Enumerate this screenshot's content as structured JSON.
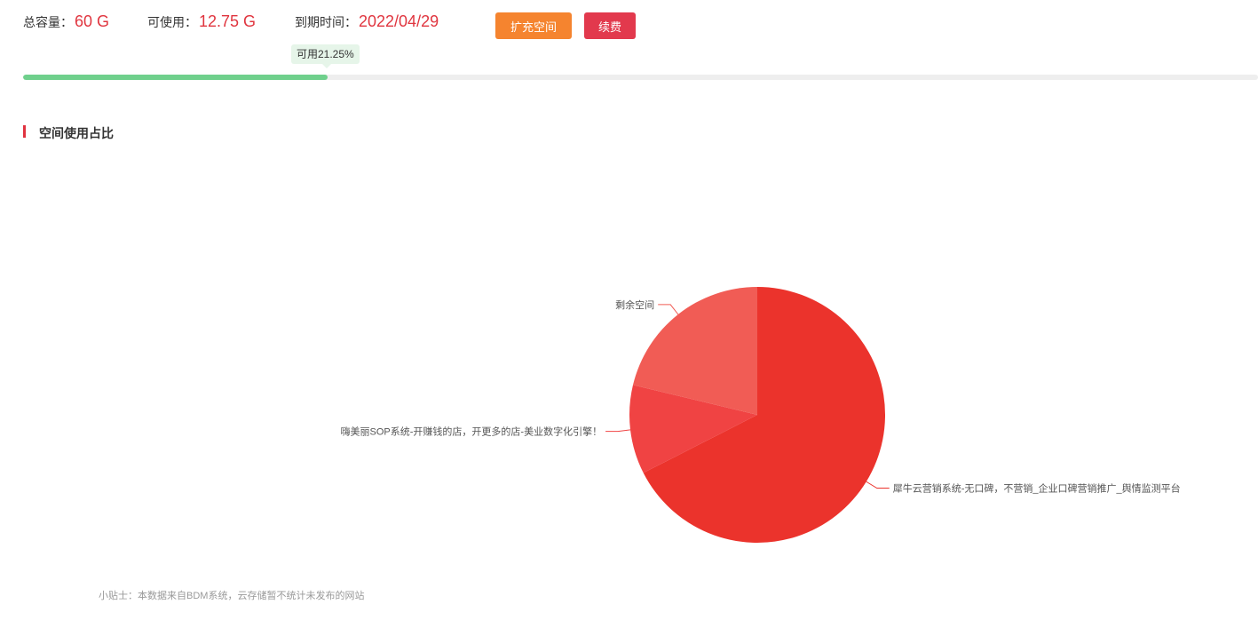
{
  "header": {
    "total": {
      "label": "总容量：",
      "value": "60 G"
    },
    "available": {
      "label": "可使用：",
      "value": "12.75 G"
    },
    "expire": {
      "label": "到期时间：",
      "value": "2022/04/29"
    },
    "expand_button": "扩充空间",
    "renew_button": "续费"
  },
  "progress": {
    "tooltip": "可用21.25%",
    "fraction": 0.2465
  },
  "section": {
    "title": "空间使用占比"
  },
  "chart_data": {
    "type": "pie",
    "categories": [
      "犀牛云营销系统-无口碑，不营销_企业口碑营销推广_舆情监测平台",
      "嗨美丽SOP系统-开赚钱的店，开更多的店-美业数字化引擎！",
      "剩余空间"
    ],
    "values": [
      67.5,
      11.25,
      21.25
    ],
    "colors": [
      "#eb332c",
      "#f04343",
      "#f15c55"
    ]
  },
  "tip": "小贴士：本数据来自BDM系统，云存储暂不统计未发布的网站",
  "colors": {
    "value_red": "#e0353f",
    "expand_orange": "#f5842f",
    "renew_red": "#e2394d",
    "accent_bar": "#e03340"
  }
}
